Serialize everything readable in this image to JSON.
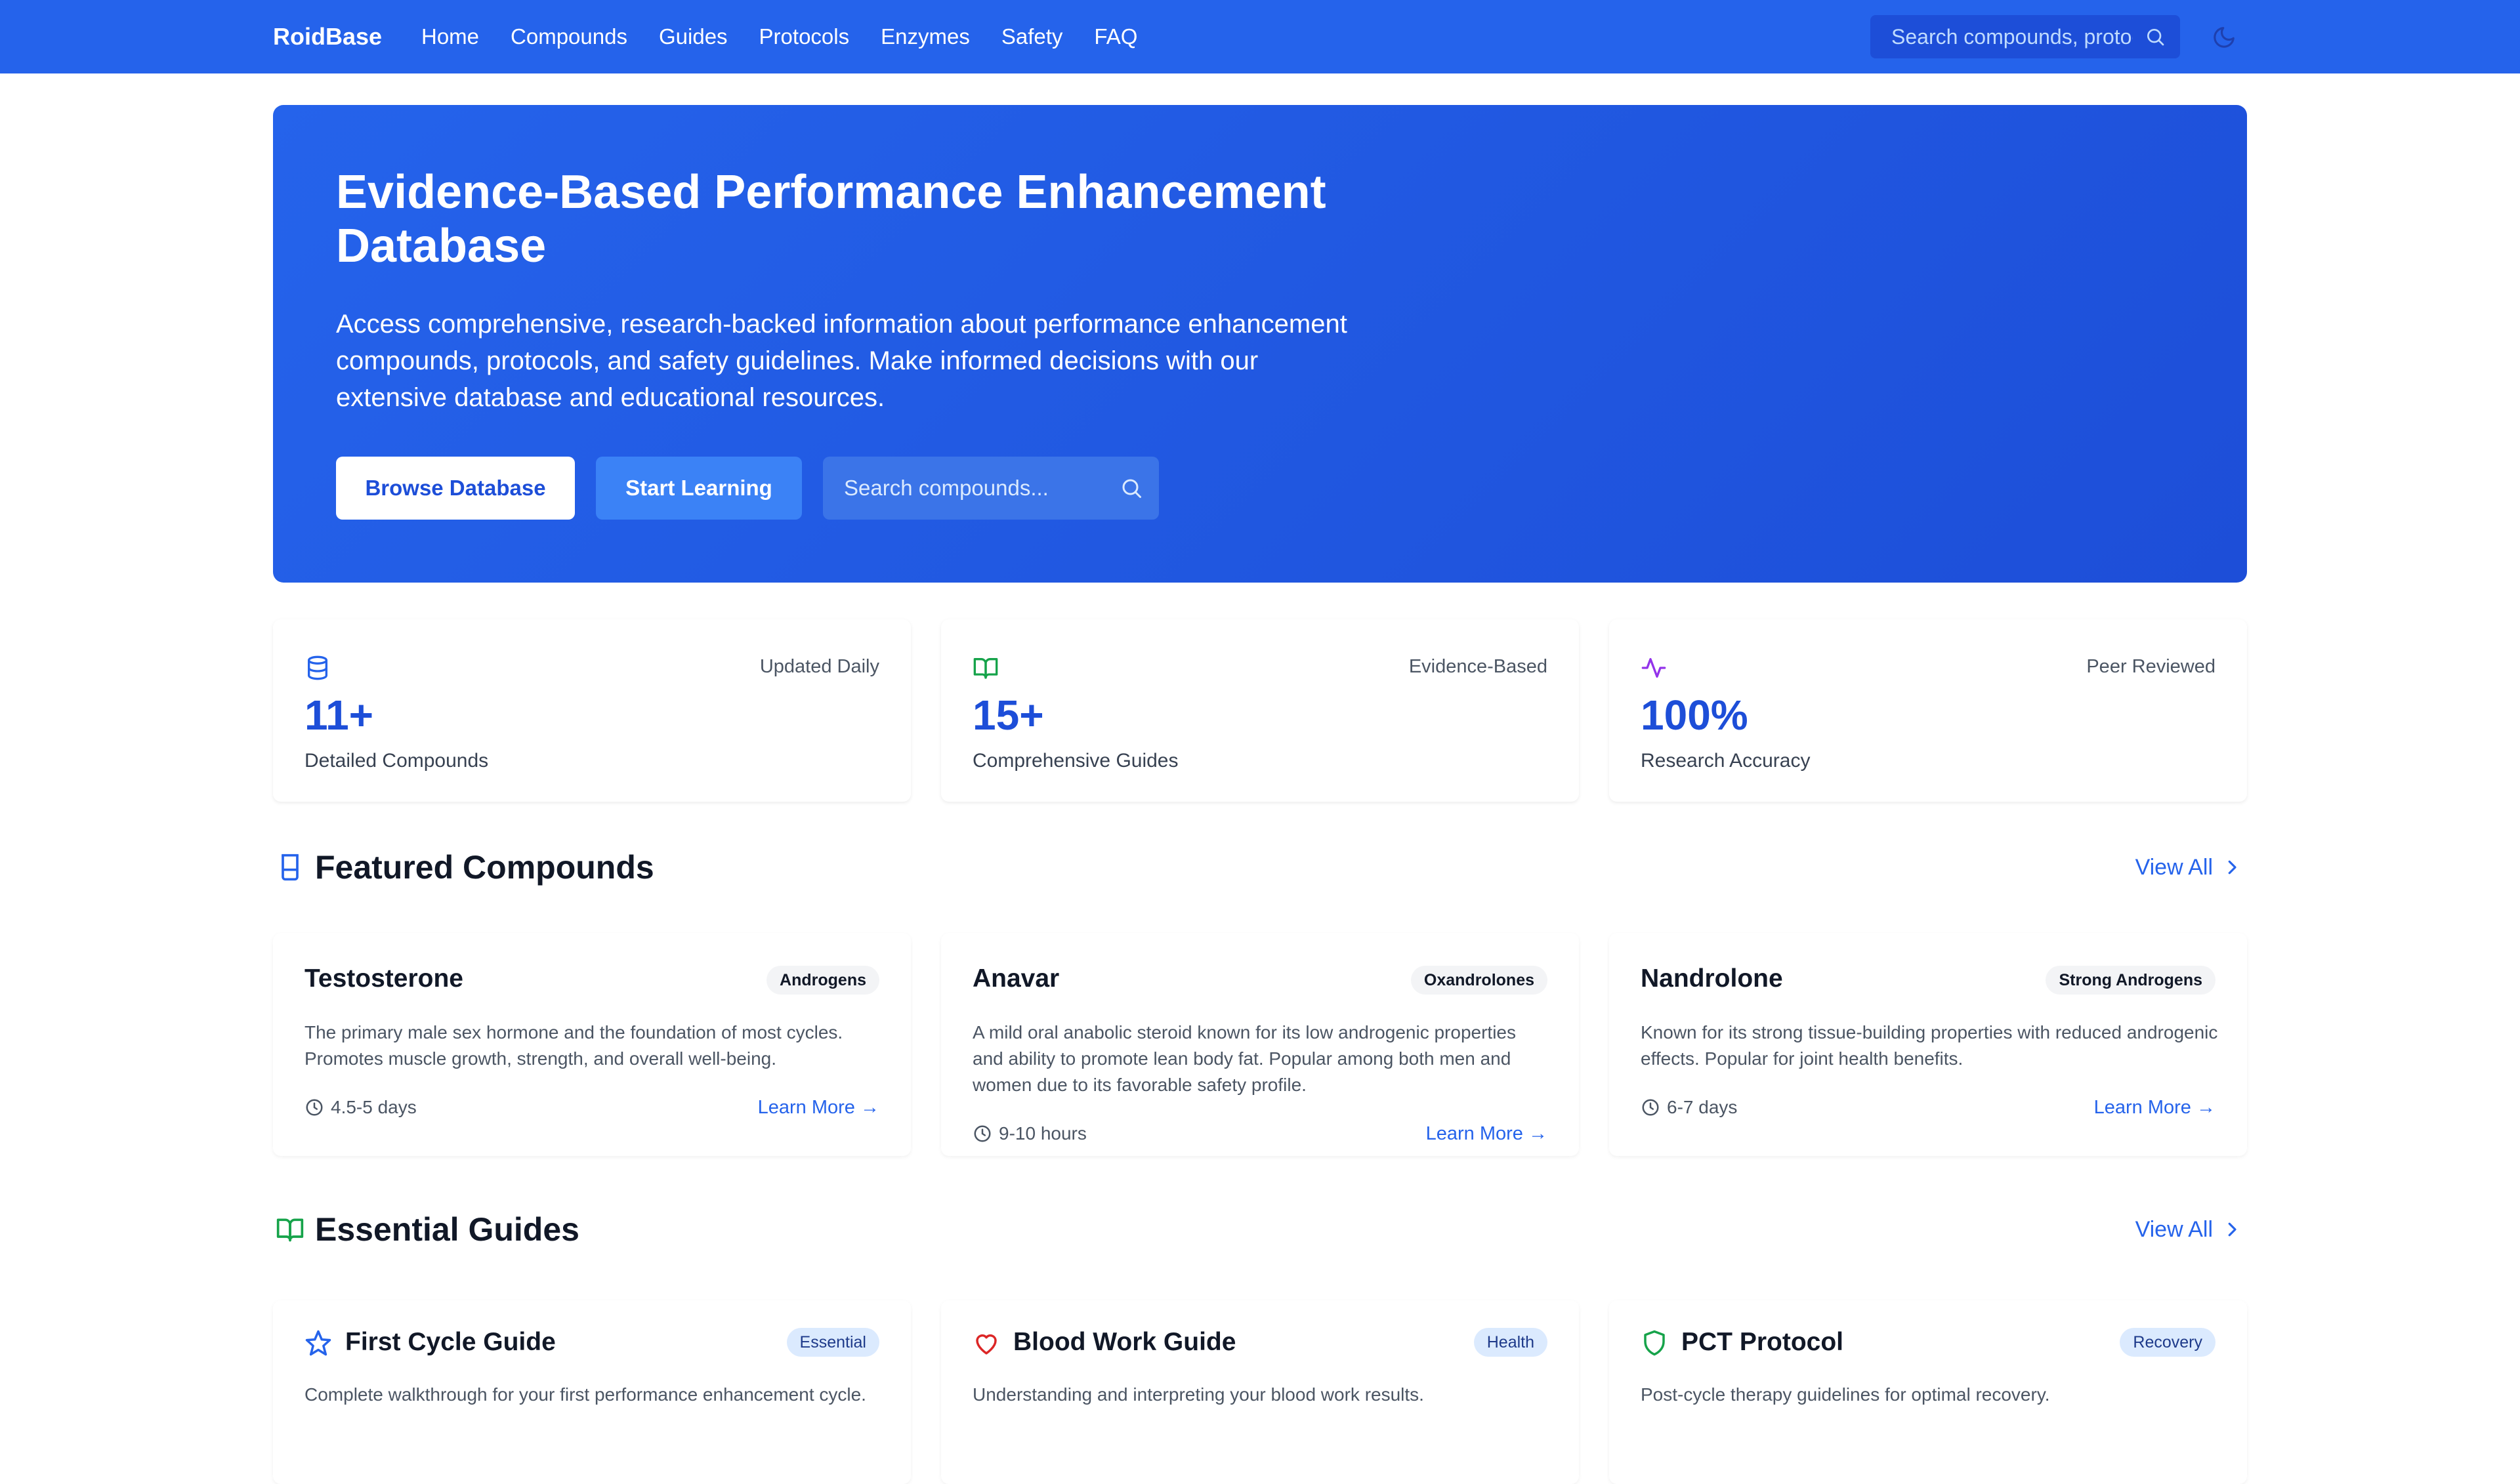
{
  "nav": {
    "brand": "RoidBase",
    "links": [
      "Home",
      "Compounds",
      "Guides",
      "Protocols",
      "Enzymes",
      "Safety",
      "FAQ"
    ],
    "search_placeholder": "Search compounds, protocols...",
    "icons": [
      "search-icon",
      "moon-icon"
    ]
  },
  "hero": {
    "title": "Evidence-Based Performance Enhancement Database",
    "description": "Access comprehensive, research-backed information about performance enhancement compounds, protocols, and safety guidelines. Make informed decisions with our extensive database and educational resources.",
    "browse_label": "Browse Database",
    "learn_label": "Start Learning",
    "search_placeholder": "Search compounds..."
  },
  "stats": [
    {
      "icon": "database-icon",
      "tag": "Updated Daily",
      "value": "11+",
      "label": "Detailed Compounds",
      "color": "#2563eb"
    },
    {
      "icon": "book-icon",
      "tag": "Evidence-Based",
      "value": "15+",
      "label": "Comprehensive Guides",
      "color": "#16a34a"
    },
    {
      "icon": "activity-icon",
      "tag": "Peer Reviewed",
      "value": "100%",
      "label": "Research Accuracy",
      "color": "#9333ea"
    }
  ],
  "featured": {
    "title": "Featured Compounds",
    "view_all": "View All",
    "items": [
      {
        "name": "Testosterone",
        "badge": "Androgens",
        "description": "The primary male sex hormone and the foundation of most cycles. Promotes muscle growth, strength, and overall well-being.",
        "half_life": "4.5-5 days",
        "learn": "Learn More →"
      },
      {
        "name": "Anavar",
        "badge": "Oxandrolones",
        "description": "A mild oral anabolic steroid known for its low androgenic properties and ability to promote lean body fat. Popular among both men and women due to its favorable safety profile.",
        "half_life": "9-10 hours",
        "learn": "Learn More →"
      },
      {
        "name": "Nandrolone",
        "badge": "Strong Androgens",
        "description": "Known for its strong tissue-building properties with reduced androgenic effects. Popular for joint health benefits.",
        "half_life": "6-7 days",
        "learn": "Learn More →"
      }
    ]
  },
  "guides": {
    "title": "Essential Guides",
    "view_all": "View All",
    "items": [
      {
        "icon": "star-icon",
        "name": "First Cycle Guide",
        "badge": "Essential",
        "description": "Complete walkthrough for your first performance enhancement cycle.",
        "color": "#2563eb"
      },
      {
        "icon": "heart-icon",
        "name": "Blood Work Guide",
        "badge": "Health",
        "description": "Understanding and interpreting your blood work results.",
        "color": "#dc2626"
      },
      {
        "icon": "shield-icon",
        "name": "PCT Protocol",
        "badge": "Recovery",
        "description": "Post-cycle therapy guidelines for optimal recovery.",
        "color": "#16a34a"
      }
    ]
  }
}
